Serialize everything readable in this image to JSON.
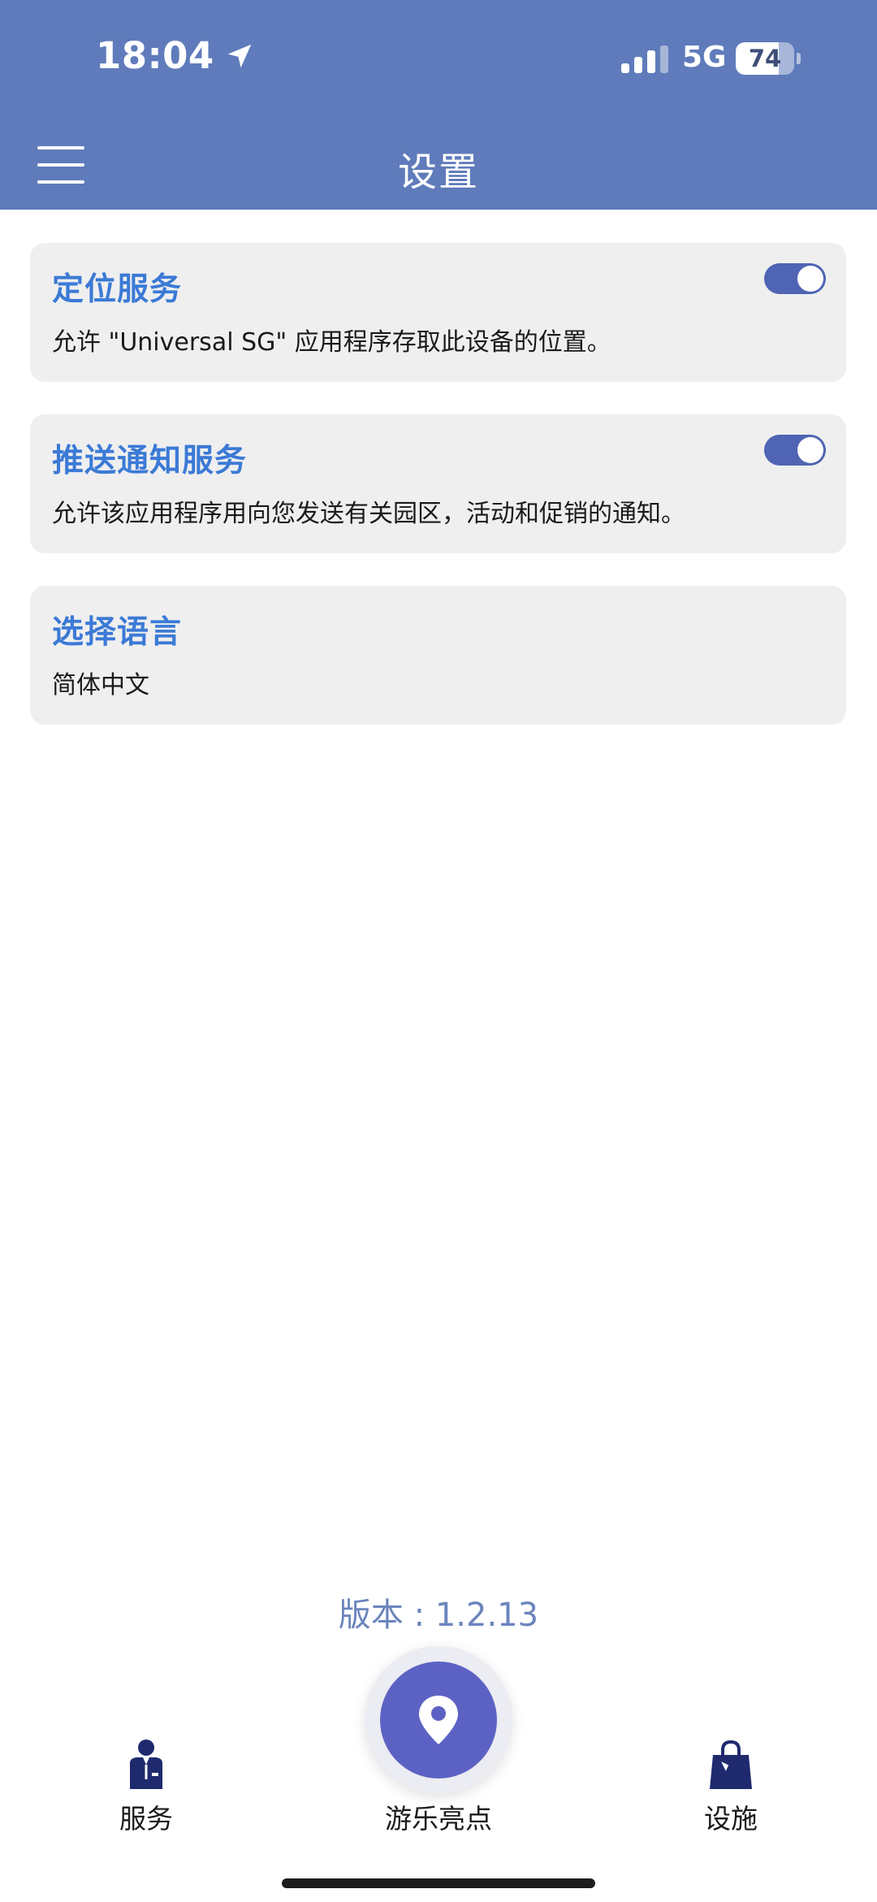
{
  "status_bar": {
    "time": "18:04",
    "network": "5G",
    "battery_level": "74",
    "battery_fraction": 0.74
  },
  "header": {
    "title": "设置"
  },
  "settings": [
    {
      "title": "定位服务",
      "description": "允许 \"Universal SG\" 应用程序存取此设备的位置。",
      "toggle_on": true
    },
    {
      "title": "推送通知服务",
      "description": "允许该应用程序用向您发送有关园区，活动和促销的通知。",
      "toggle_on": true
    },
    {
      "title": "选择语言",
      "description": "简体中文"
    }
  ],
  "version_text": "版本 : 1.2.13",
  "bottom_nav": {
    "left_label": "服务",
    "center_label": "游乐亮点",
    "right_label": "设施"
  },
  "colors": {
    "header_bg": "#5f7bbb",
    "accent_title": "#3b7ad6",
    "toggle_on": "#4f64b4",
    "fab": "#5c62c4",
    "nav_icon": "#1f2a6e"
  }
}
